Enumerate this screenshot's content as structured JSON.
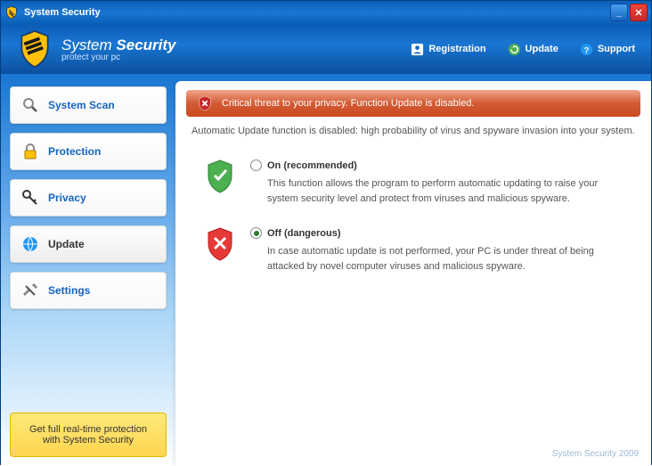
{
  "window": {
    "title": "System Security"
  },
  "header": {
    "logo_line1a": "System ",
    "logo_line1b": "Security",
    "logo_line2": "protect your pc",
    "links": {
      "registration": "Registration",
      "update": "Update",
      "support": "Support"
    }
  },
  "sidebar": {
    "scan": "System Scan",
    "protection": "Protection",
    "privacy": "Privacy",
    "update": "Update",
    "settings": "Settings",
    "promo": "Get full real-time protection with System Security"
  },
  "content": {
    "alert": "Critical threat to your privacy. Function Update is disabled.",
    "desc": "Automatic Update function is disabled: high probability of virus and spyware invasion into your system.",
    "option_on": {
      "label": "On (recommended)",
      "desc": "This function allows the program to perform automatic updating to raise your system security level and protect from viruses and malicious spyware."
    },
    "option_off": {
      "label": "Off (dangerous)",
      "desc": "In case automatic update is not performed, your PC is under threat of being attacked by novel computer viruses and malicious spyware."
    },
    "footer": "System Security 2009"
  }
}
